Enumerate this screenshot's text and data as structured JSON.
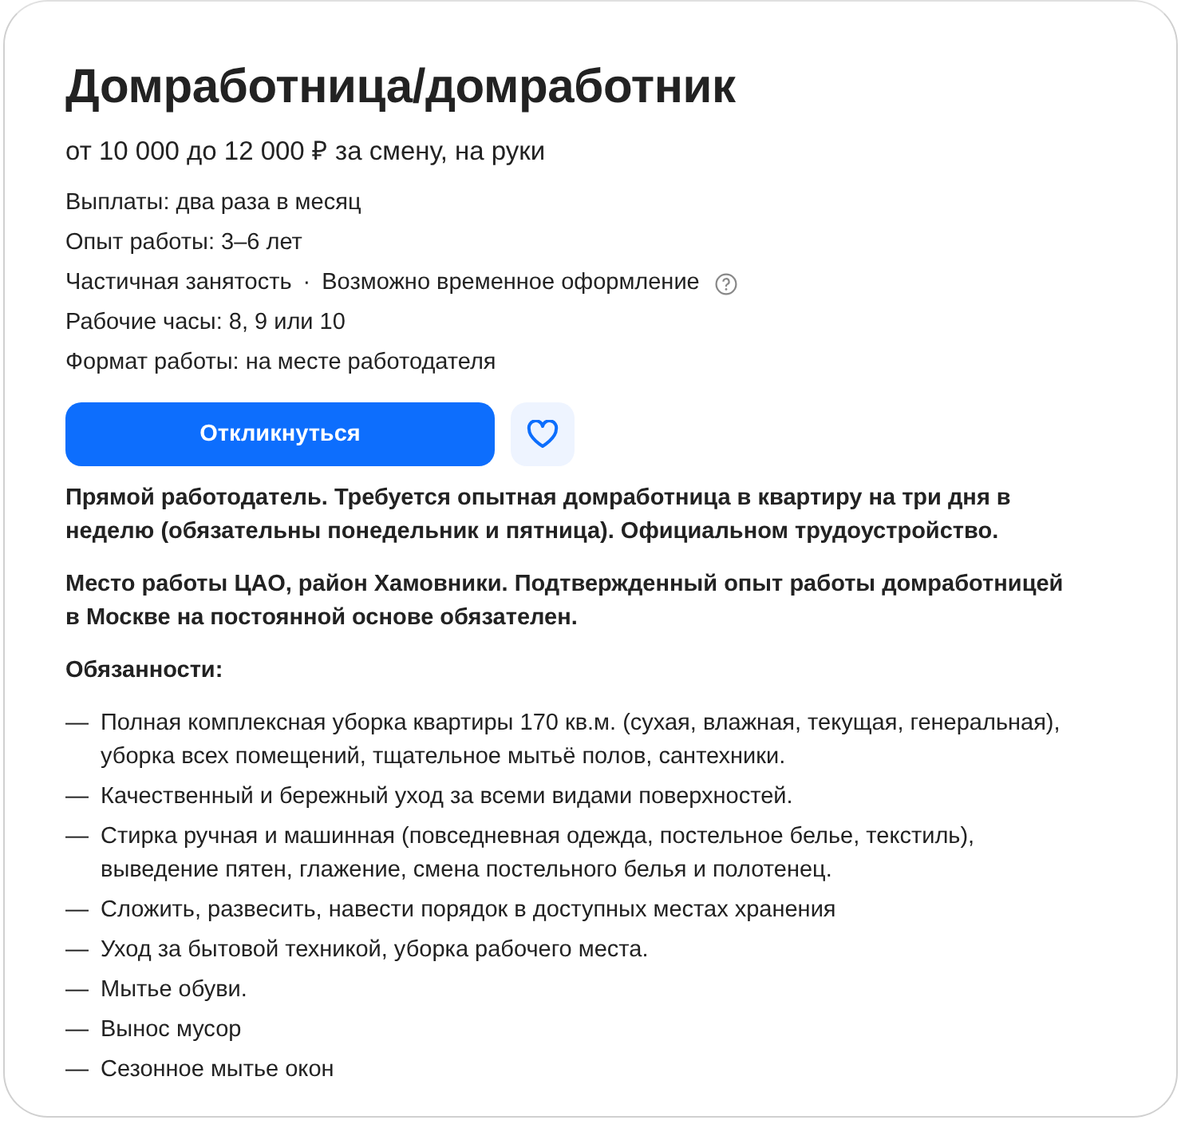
{
  "title": "Домработница/домработник",
  "salary": "от 10 000 до 12 000 ₽ за смену, на руки",
  "details": [
    {
      "parts": [
        "Выплаты: два раза в месяц"
      ],
      "help_icon": false
    },
    {
      "parts": [
        "Опыт работы: 3–6 лет"
      ],
      "help_icon": false
    },
    {
      "parts": [
        "Частичная занятость",
        "·",
        "Возможно временное оформление"
      ],
      "help_icon": true
    },
    {
      "parts": [
        "Рабочие часы: 8, 9 или 10"
      ],
      "help_icon": false
    },
    {
      "parts": [
        "Формат работы: на месте работодателя"
      ],
      "help_icon": false
    }
  ],
  "apply_button": "Откликнуться",
  "favorite": {
    "selected": false
  },
  "paragraphs": [
    "Прямой работодатель. Требуется опытная домработница в квартиру на три дня в неделю (обязательны понедельник и пятница). Официальном трудоустройство.",
    "Место работы ЦАО, район Хамовники. Подтвержденный опыт работы домработницей в Москве на постоянной основе обязателен."
  ],
  "duties_heading": "Обязанности:",
  "duties": [
    {
      "marker": "—",
      "text": "Полная комплексная уборка квартиры 170 кв.м. (сухая, влажная, текущая, генеральная), уборка всех помещений, тщательное мытьё полов, сантехники."
    },
    {
      "marker": "—",
      "text": "Качественный и бережный уход за всеми видами поверхностей."
    },
    {
      "marker": "—",
      "text": "Стирка ручная и машинная (повседневная одежда, постельное белье, текстиль), выведение пятен, глажение, смена постельного белья и полотенец."
    },
    {
      "marker": "—",
      "text": "Сложить, развесить, навести порядок в доступных местах хранения"
    },
    {
      "marker": "—",
      "text": "Уход за бытовой техникой, уборка рабочего места."
    },
    {
      "marker": "—",
      "text": "Мытье обуви."
    },
    {
      "marker": "—",
      "text": "Вынос мусор"
    },
    {
      "marker": "—",
      "text": "Сезонное мытье окон"
    }
  ]
}
